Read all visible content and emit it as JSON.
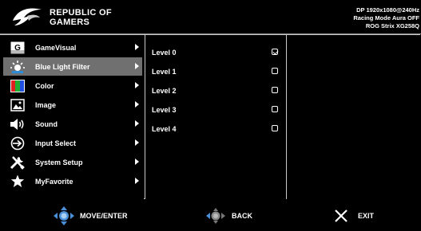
{
  "header": {
    "brand_line1": "REPUBLIC OF",
    "brand_line2": "GAMERS",
    "status_line1": "DP 1920x1080@240Hz",
    "status_line2": "Racing Mode  Aura OFF",
    "status_line3": "ROG Strix XG258Q"
  },
  "menu": {
    "items": [
      {
        "label": "GameVisual",
        "icon": "gamevisual-icon"
      },
      {
        "label": "Blue Light Filter",
        "icon": "blue-light-filter-icon",
        "selected": true
      },
      {
        "label": "Color",
        "icon": "color-icon"
      },
      {
        "label": "Image",
        "icon": "image-icon"
      },
      {
        "label": "Sound",
        "icon": "speaker-icon"
      },
      {
        "label": "Input Select",
        "icon": "input-select-icon"
      },
      {
        "label": "System Setup",
        "icon": "tools-icon"
      },
      {
        "label": "MyFavorite",
        "icon": "star-icon"
      }
    ],
    "gamevisual_glyph": "G"
  },
  "submenu": {
    "items": [
      {
        "label": "Level 0",
        "checked": true
      },
      {
        "label": "Level 1",
        "checked": false
      },
      {
        "label": "Level 2",
        "checked": false
      },
      {
        "label": "Level 3",
        "checked": false
      },
      {
        "label": "Level 4",
        "checked": false
      }
    ]
  },
  "footer": {
    "move_label": "MOVE/ENTER",
    "back_label": "BACK",
    "exit_label": "EXIT"
  },
  "colors": {
    "background": "#000000",
    "selected": "#707070",
    "dpad": "#4a90d9",
    "text": "#ffffff"
  }
}
